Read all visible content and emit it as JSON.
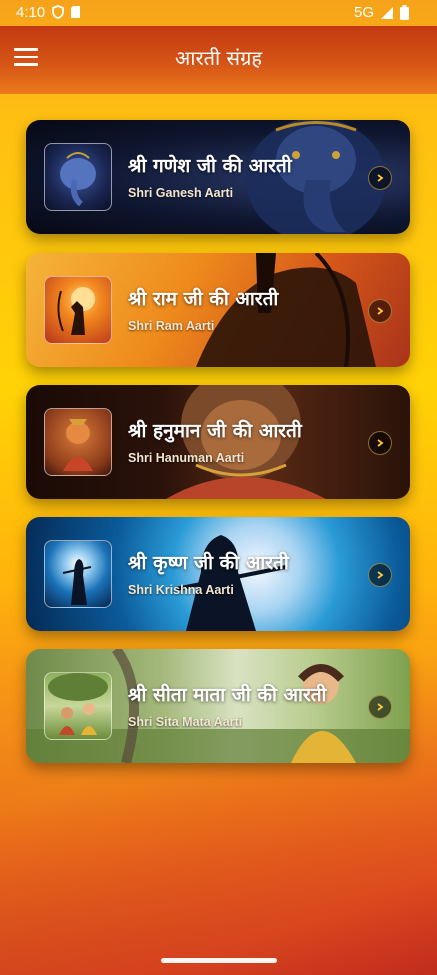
{
  "status_bar": {
    "time": "4:10",
    "network": "5G"
  },
  "app_bar": {
    "title": "आरती संग्रह",
    "menu_icon": "hamburger-menu-icon"
  },
  "aartis": [
    {
      "title_hi": "श्री गणेश जी की आरती",
      "title_en": "Shri Ganesh Aarti"
    },
    {
      "title_hi": "श्री राम जी की आरती",
      "title_en": "Shri Ram Aarti"
    },
    {
      "title_hi": "श्री हनुमान जी की आरती",
      "title_en": "Shri Hanuman Aarti"
    },
    {
      "title_hi": "श्री कृष्ण जी की आरती",
      "title_en": "Shri Krishna Aarti"
    },
    {
      "title_hi": "श्री सीता माता जी की आरती",
      "title_en": "Shri Sita Mata Aarti"
    }
  ]
}
